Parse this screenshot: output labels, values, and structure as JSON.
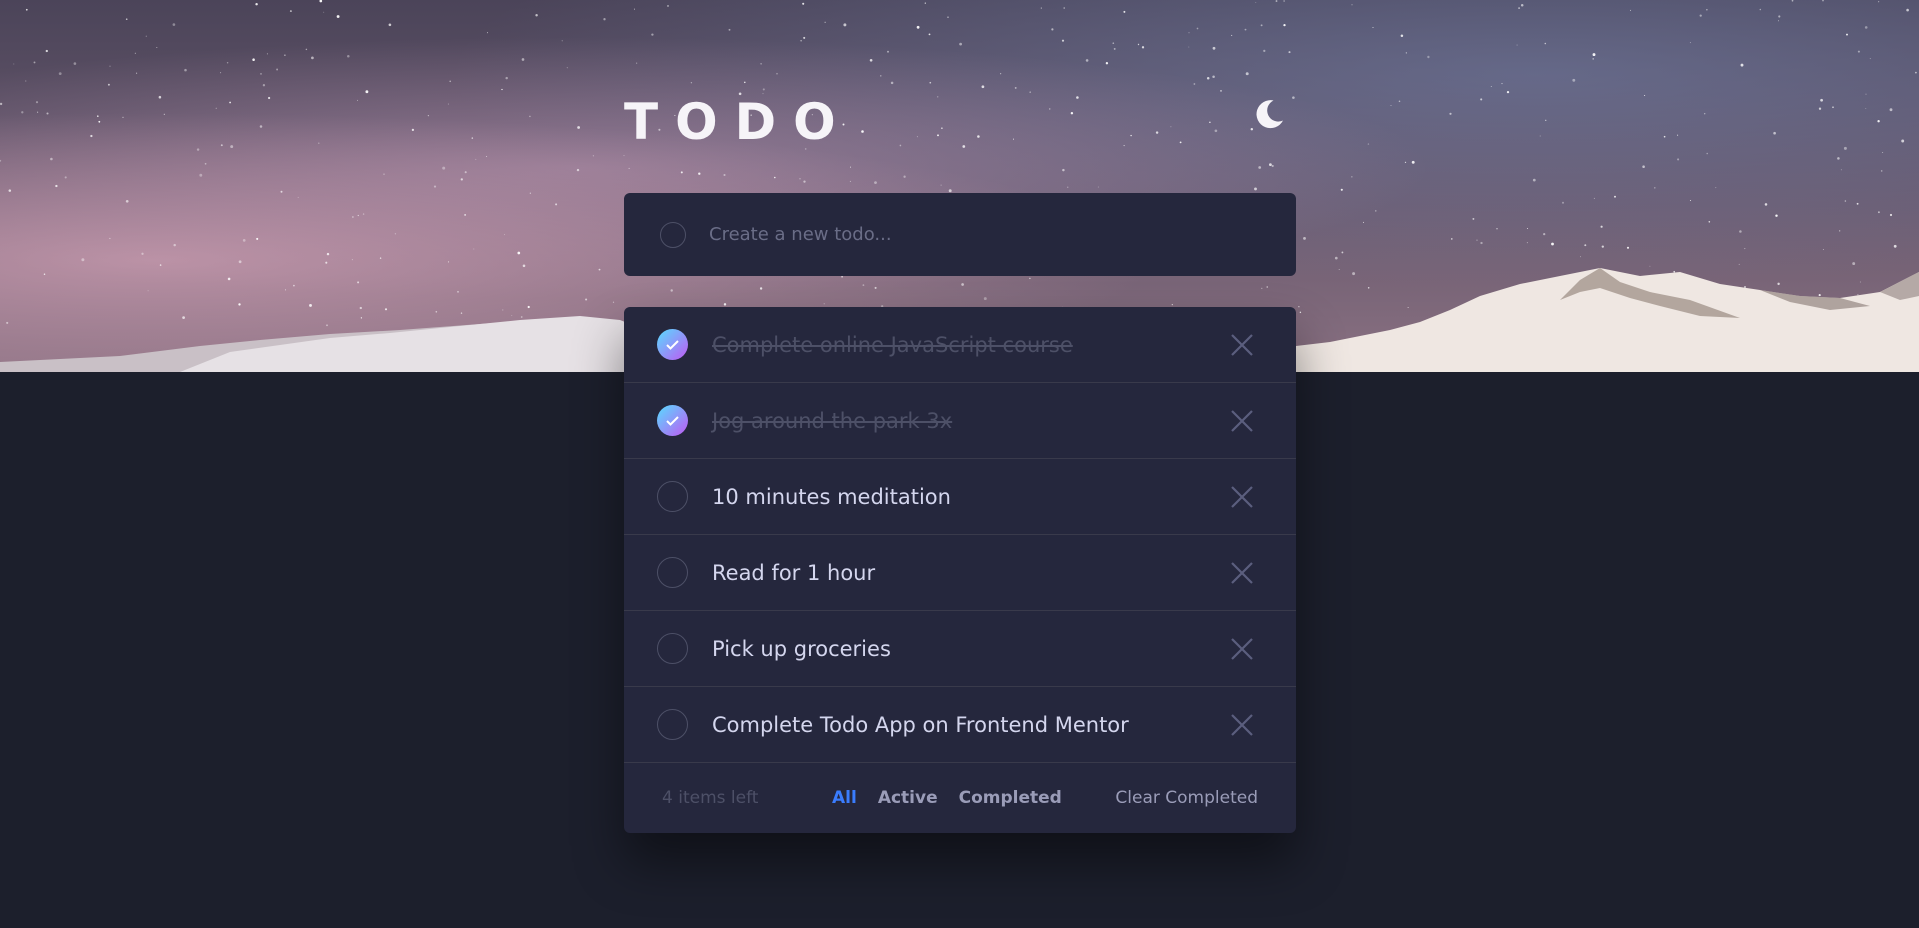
{
  "header": {
    "title": "TODO",
    "theme_toggle_icon": "moon-icon"
  },
  "new_todo": {
    "placeholder": "Create a new todo..."
  },
  "todos": [
    {
      "text": "Complete online JavaScript course",
      "completed": true
    },
    {
      "text": "Jog around the park 3x",
      "completed": true
    },
    {
      "text": "10 minutes meditation",
      "completed": false
    },
    {
      "text": "Read for 1 hour",
      "completed": false
    },
    {
      "text": "Pick up groceries",
      "completed": false
    },
    {
      "text": "Complete Todo App on Frontend Mentor",
      "completed": false
    }
  ],
  "footer": {
    "items_left": "4 items left",
    "filters": [
      {
        "label": "All",
        "active": true
      },
      {
        "label": "Active",
        "active": false
      },
      {
        "label": "Completed",
        "active": false
      }
    ],
    "clear_label": "Clear Completed"
  },
  "colors": {
    "page_background": "#1c1f2c",
    "card_background": "#25273d",
    "active_filter": "#3a7cfd",
    "check_gradient_start": "#57ddff",
    "check_gradient_end": "#c058f3"
  }
}
